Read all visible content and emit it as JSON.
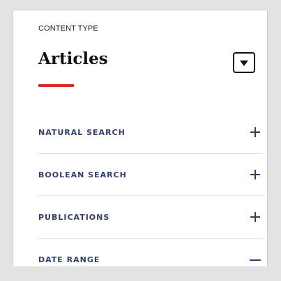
{
  "content_type": {
    "label": "CONTENT TYPE",
    "selected": "Articles"
  },
  "filters": [
    {
      "label": "NATURAL SEARCH",
      "state": "collapsed",
      "icon": "plus-icon"
    },
    {
      "label": "BOOLEAN SEARCH",
      "state": "collapsed",
      "icon": "plus-icon"
    },
    {
      "label": "PUBLICATIONS",
      "state": "collapsed",
      "icon": "plus-icon"
    },
    {
      "label": "DATE RANGE",
      "state": "expanded",
      "icon": "minus-icon"
    }
  ],
  "colors": {
    "accent": "#d62b2b",
    "filter_text": "#2f3d73",
    "background": "#e3e3e3",
    "panel": "#ffffff"
  }
}
